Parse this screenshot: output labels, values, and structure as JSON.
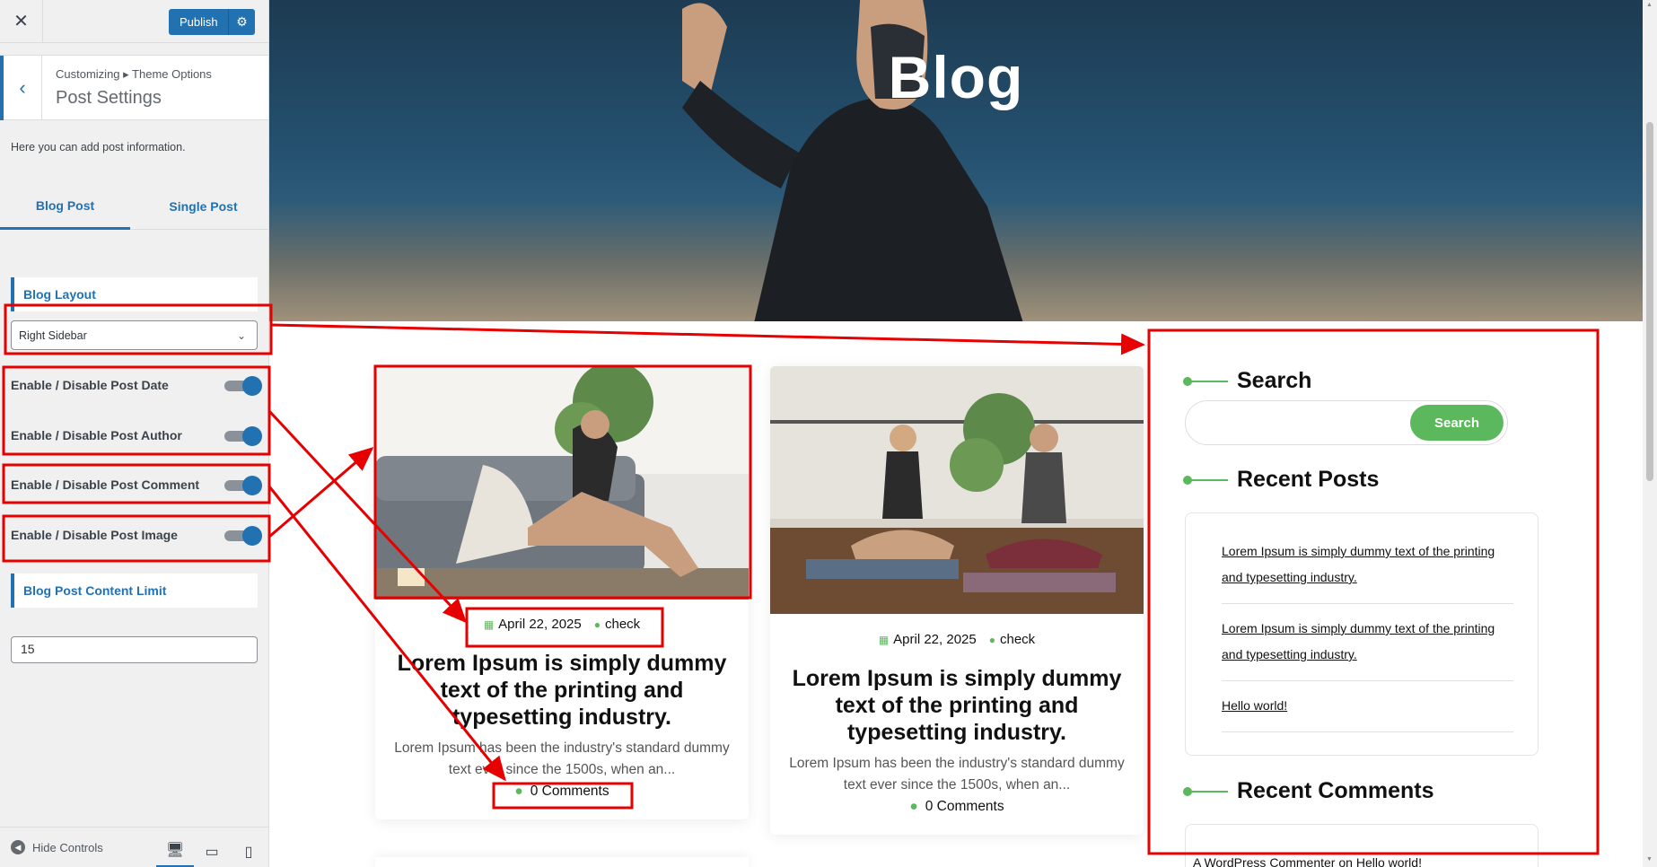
{
  "customizer": {
    "close_icon": "close-icon",
    "publish_label": "Publish",
    "gear_icon": "gear-icon",
    "breadcrumb": "Customizing ▸ Theme Options",
    "title": "Post Settings",
    "description": "Here you can add post information.",
    "tabs": [
      {
        "label": "Blog Post",
        "active": true
      },
      {
        "label": "Single Post",
        "active": false
      }
    ],
    "blog_layout_label": "Blog Layout",
    "blog_layout_value": "Right Sidebar",
    "toggles": [
      {
        "label": "Enable / Disable Post Date",
        "on": true
      },
      {
        "label": "Enable / Disable Post Author",
        "on": true
      },
      {
        "label": "Enable / Disable Post Comment",
        "on": true
      },
      {
        "label": "Enable / Disable Post Image",
        "on": true
      }
    ],
    "content_limit_label": "Blog Post Content Limit",
    "content_limit_value": "15",
    "hide_controls_label": "Hide Controls",
    "devices": [
      "desktop",
      "tablet",
      "mobile"
    ]
  },
  "preview": {
    "hero_title": "Blog",
    "posts": [
      {
        "date": "April 22, 2025",
        "author": "check",
        "title": "Lorem Ipsum is simply dummy text of the printing and typesetting industry.",
        "excerpt": "Lorem Ipsum has been the industry's standard dummy text ever since the 1500s, when an...",
        "comments": "0 Comments"
      },
      {
        "date": "April 22, 2025",
        "author": "check",
        "title": "Lorem Ipsum is simply dummy text of the printing and typesetting industry.",
        "excerpt": "Lorem Ipsum has been the industry's standard dummy text ever since the 1500s, when an...",
        "comments": "0 Comments"
      }
    ],
    "sidebar": {
      "search_heading": "Search",
      "search_button": "Search",
      "recent_posts_heading": "Recent Posts",
      "recent_posts": [
        "Lorem Ipsum is simply dummy text of the printing and typesetting industry.",
        "Lorem Ipsum is simply dummy text of the printing and typesetting industry.",
        "Hello world!"
      ],
      "recent_comments_heading": "Recent Comments",
      "recent_comment_author": "A WordPress Commenter",
      "recent_comment_on": "on",
      "recent_comment_post": "Hello world!"
    }
  },
  "colors": {
    "wp_blue": "#2271b1",
    "accent_green": "#5cb85c",
    "annotation_red": "#e60000"
  }
}
